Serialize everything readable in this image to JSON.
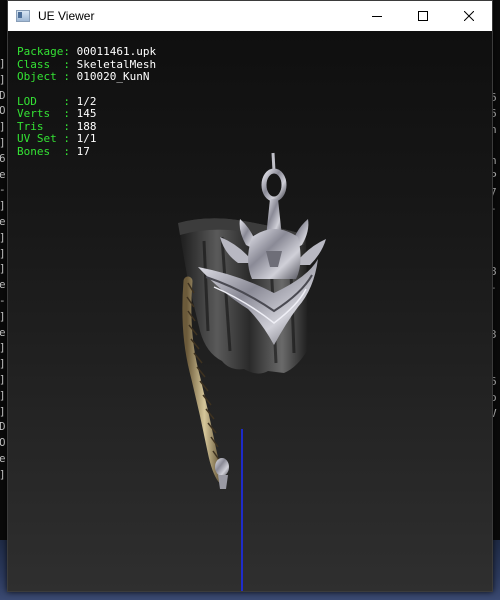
{
  "window": {
    "title": "UE Viewer",
    "icons": {
      "app": "app-window-icon",
      "minimize": "minimize-icon",
      "maximize": "maximize-icon",
      "close": "close-icon"
    }
  },
  "mesh_info": {
    "package": {
      "label": "Package",
      "value": "00011461.upk"
    },
    "class": {
      "label": "Class  ",
      "value": "SkeletalMesh"
    },
    "object": {
      "label": "Object ",
      "value": "010020_KunN"
    },
    "lod": {
      "label": "LOD    ",
      "value": "1/2"
    },
    "verts": {
      "label": "Verts  ",
      "value": "145"
    },
    "tris": {
      "label": "Tris   ",
      "value": "188"
    },
    "uvset": {
      "label": "UV Set ",
      "value": "1/1"
    },
    "bones": {
      "label": "Bones  ",
      "value": "17"
    }
  },
  "colors": {
    "label_green": "#34e234",
    "value_white": "#ffffff",
    "axis_blue": "#1a2cff"
  },
  "background_console": {
    "left": [
      "]",
      "]",
      "D",
      "O",
      "]",
      "]",
      "6",
      "e",
      "-",
      "]",
      "e",
      "]",
      "]",
      "]",
      "e",
      "-",
      "]",
      "e",
      "]",
      "]",
      "]",
      "]",
      "]",
      "D",
      "O",
      "e",
      "]"
    ],
    "right": [
      "6",
      "6",
      "n",
      "",
      "n",
      "P",
      "7",
      "-",
      "",
      "",
      "",
      "8",
      "-",
      "",
      "",
      "3",
      "",
      "",
      "6",
      "o",
      "V"
    ]
  }
}
